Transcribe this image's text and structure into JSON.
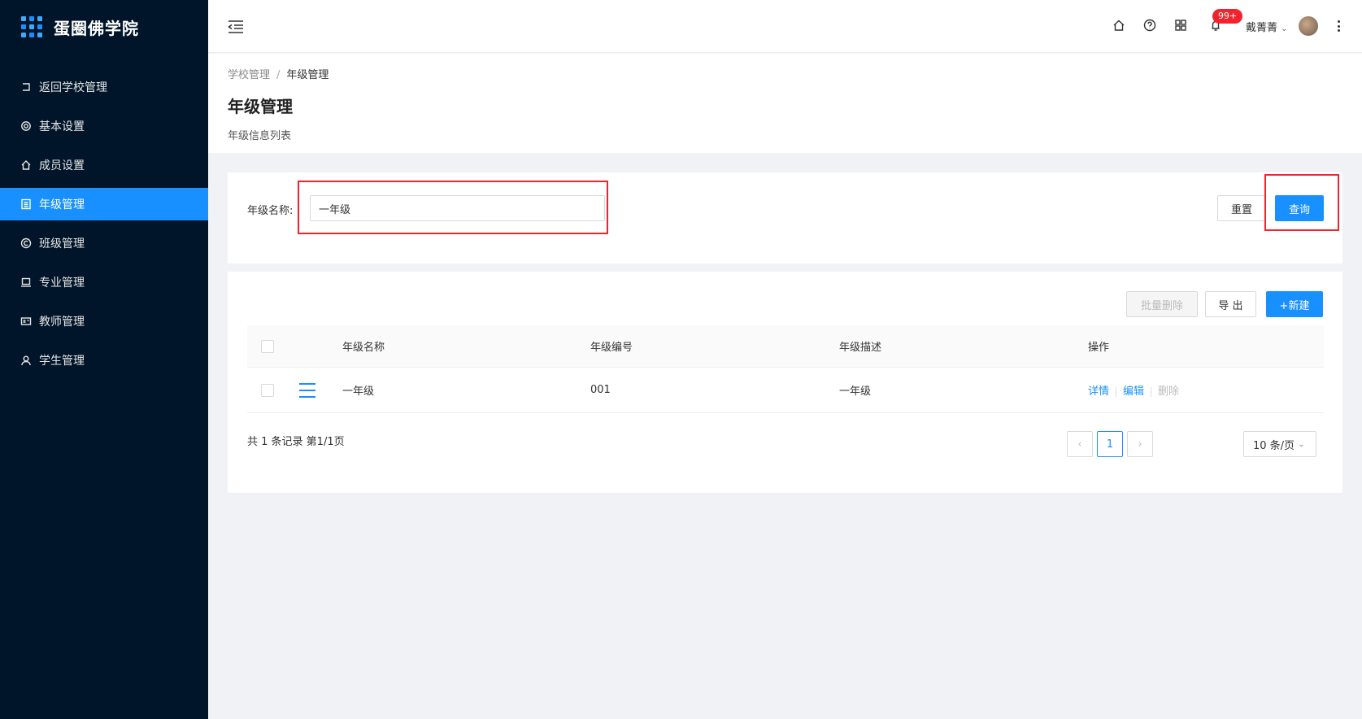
{
  "app": {
    "title": "蛋圈佛学院"
  },
  "sidebar": {
    "items": [
      {
        "label": "返回学校管理",
        "icon": "return-icon",
        "active": false
      },
      {
        "label": "基本设置",
        "icon": "gear-icon",
        "active": false
      },
      {
        "label": "成员设置",
        "icon": "home-icon",
        "active": false
      },
      {
        "label": "年级管理",
        "icon": "list-icon",
        "active": true
      },
      {
        "label": "班级管理",
        "icon": "copyright-icon",
        "active": false
      },
      {
        "label": "专业管理",
        "icon": "laptop-icon",
        "active": false
      },
      {
        "label": "教师管理",
        "icon": "id-card-icon",
        "active": false
      },
      {
        "label": "学生管理",
        "icon": "user-icon",
        "active": false
      }
    ]
  },
  "header": {
    "notification_count": "99+",
    "username": "戴菁菁"
  },
  "breadcrumb": {
    "parent": "学校管理",
    "separator": "/",
    "current": "年级管理"
  },
  "page": {
    "title": "年级管理",
    "subtitle": "年级信息列表"
  },
  "search": {
    "label": "年级名称:",
    "value": "一年级",
    "reset_label": "重置",
    "query_label": "查询"
  },
  "toolbar": {
    "batch_delete_label": "批量删除",
    "export_label": "导 出",
    "new_label": "+新建"
  },
  "table": {
    "columns": [
      "年级名称",
      "年级编号",
      "年级描述",
      "操作"
    ],
    "rows": [
      {
        "name": "一年级",
        "code": "001",
        "desc": "一年级",
        "actions": [
          "详情",
          "编辑",
          "删除"
        ]
      }
    ]
  },
  "pagination": {
    "summary": "共 1 条记录 第1/1页",
    "current_page": "1",
    "prev": "‹",
    "next": "›",
    "page_size": "10 条/页"
  },
  "colors": {
    "accent": "#1890ff",
    "sidebar_bg": "#001529",
    "highlight": "#f5222d"
  }
}
